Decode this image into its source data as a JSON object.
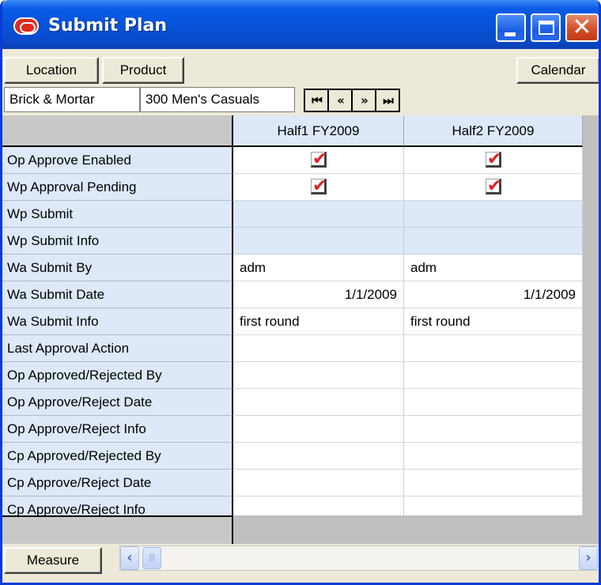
{
  "window": {
    "title": "Submit Plan"
  },
  "toolbar": {
    "location_label": "Location",
    "product_label": "Product",
    "calendar_label": "Calendar",
    "measure_label": "Measure"
  },
  "context": {
    "location_value": "Brick & Mortar",
    "product_value": "300 Men's Casuals"
  },
  "navigation": {
    "first": "⏮",
    "prev": "«",
    "next": "»",
    "last": "⏭"
  },
  "grid": {
    "columns": [
      "Half1 FY2009",
      "Half2 FY2009"
    ],
    "rows": [
      {
        "label": "Op Approve Enabled",
        "type": "check",
        "cells": [
          true,
          true
        ]
      },
      {
        "label": "Wp Approval Pending",
        "type": "check",
        "cells": [
          true,
          true
        ]
      },
      {
        "label": "Wp Submit",
        "type": "tint",
        "cells": [
          "",
          ""
        ]
      },
      {
        "label": "Wp Submit Info",
        "type": "tint",
        "cells": [
          "",
          ""
        ]
      },
      {
        "label": "Wa Submit By",
        "type": "text",
        "cells": [
          "adm",
          "adm"
        ]
      },
      {
        "label": "Wa Submit Date",
        "type": "num",
        "cells": [
          "1/1/2009",
          "1/1/2009"
        ]
      },
      {
        "label": "Wa Submit Info",
        "type": "text",
        "cells": [
          "first round",
          "first round"
        ]
      },
      {
        "label": "Last Approval Action",
        "type": "text",
        "cells": [
          "",
          ""
        ]
      },
      {
        "label": "Op Approved/Rejected By",
        "type": "text",
        "cells": [
          "",
          ""
        ]
      },
      {
        "label": "Op Approve/Reject Date",
        "type": "text",
        "cells": [
          "",
          ""
        ]
      },
      {
        "label": "Op Approve/Reject Info",
        "type": "text",
        "cells": [
          "",
          ""
        ]
      },
      {
        "label": "Cp Approved/Rejected By",
        "type": "text",
        "cells": [
          "",
          ""
        ]
      },
      {
        "label": "Cp Approve/Reject Date",
        "type": "text",
        "cells": [
          "",
          ""
        ]
      },
      {
        "label": "Cp Approve/Reject Info",
        "type": "text",
        "cells": [
          "",
          ""
        ]
      }
    ]
  },
  "colors": {
    "title_bar": "#0552d6",
    "header_tint": "#dde8f8",
    "check_mark": "#e02020"
  }
}
